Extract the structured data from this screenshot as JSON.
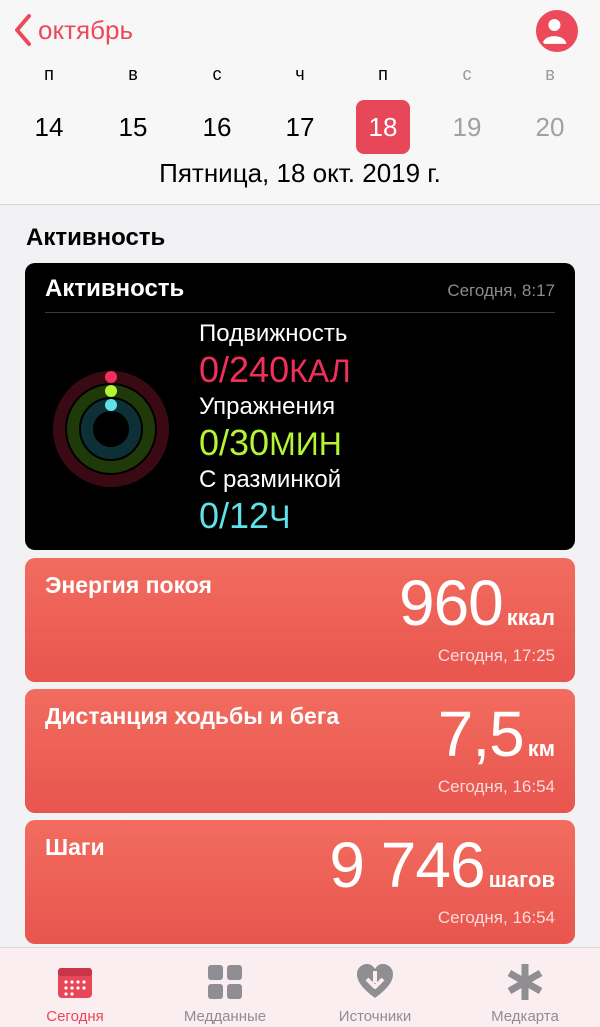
{
  "header": {
    "back_label": "октябрь",
    "weekdays": [
      "п",
      "в",
      "с",
      "ч",
      "п",
      "с",
      "в"
    ],
    "days": [
      "14",
      "15",
      "16",
      "17",
      "18",
      "19",
      "20"
    ],
    "selected_day": "18",
    "date_title": "Пятница, 18 окт. 2019 г."
  },
  "section": {
    "title": "Активность"
  },
  "activity": {
    "title": "Активность",
    "time": "Сегодня, 8:17",
    "move": {
      "label": "Подвижность",
      "value": "0/240",
      "unit": "КАЛ",
      "color": "#f0305a"
    },
    "exercise": {
      "label": "Упражнения",
      "value": "0/30",
      "unit": "МИН",
      "color": "#b4f535"
    },
    "stand": {
      "label": "С разминкой",
      "value": "0/12",
      "unit": "Ч",
      "color": "#5fe0ea"
    }
  },
  "metrics": [
    {
      "title": "Энергия покоя",
      "value": "960",
      "unit": "ккал",
      "time": "Сегодня, 17:25"
    },
    {
      "title": "Дистанция ходьбы и бега",
      "value": "7,5",
      "unit": "км",
      "time": "Сегодня, 16:54"
    },
    {
      "title": "Шаги",
      "value": "9 746",
      "unit": "шагов",
      "time": "Сегодня, 16:54"
    }
  ],
  "tabbar": {
    "tabs": [
      {
        "label": "Сегодня",
        "icon": "calendar-icon"
      },
      {
        "label": "Медданные",
        "icon": "grid-icon"
      },
      {
        "label": "Источники",
        "icon": "heart-download-icon"
      },
      {
        "label": "Медкарта",
        "icon": "asterisk-icon"
      }
    ],
    "active_color": "#e8475a",
    "inactive_color": "#8e8e93"
  }
}
